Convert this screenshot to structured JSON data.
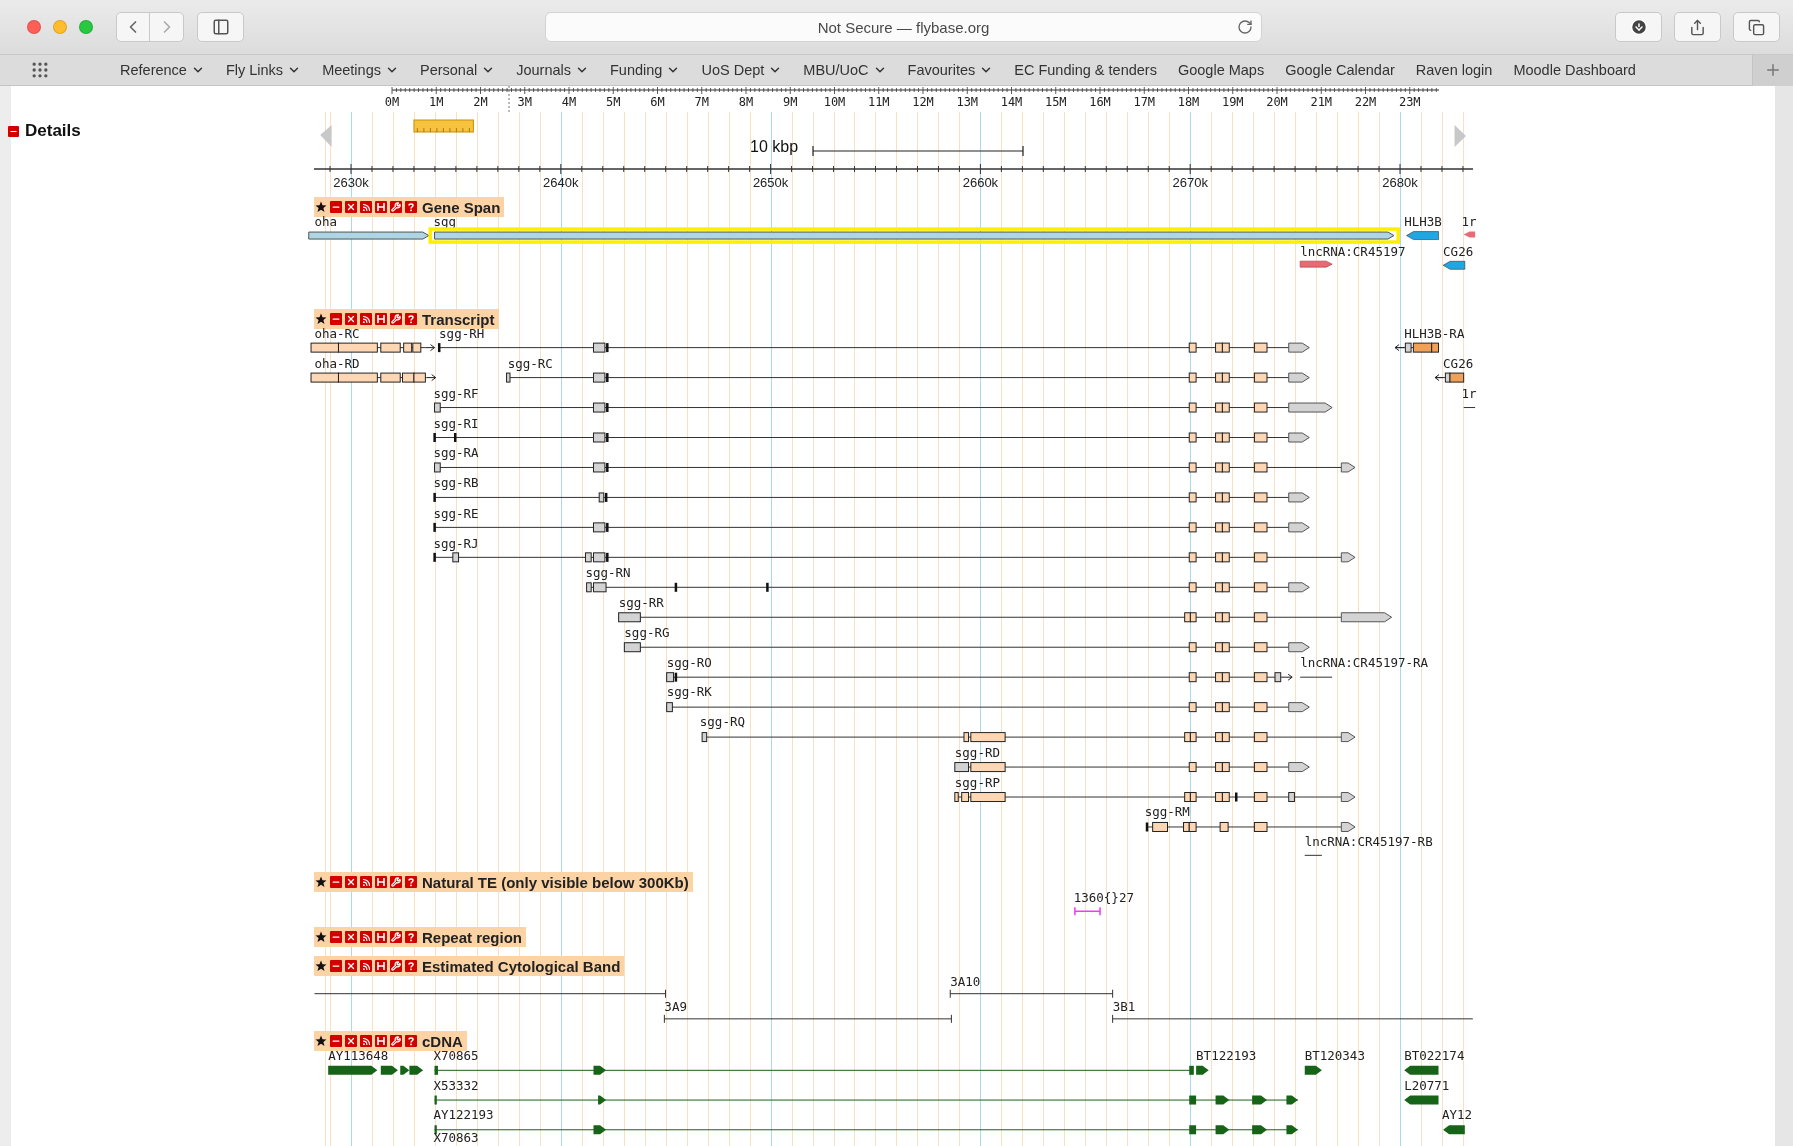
{
  "browser": {
    "address": "Not Secure — flybase.org"
  },
  "bookmarks": [
    {
      "label": "Reference",
      "menu": true
    },
    {
      "label": "Fly Links",
      "menu": true
    },
    {
      "label": "Meetings",
      "menu": true
    },
    {
      "label": "Personal",
      "menu": true
    },
    {
      "label": "Journals",
      "menu": true
    },
    {
      "label": "Funding",
      "menu": true
    },
    {
      "label": "UoS Dept",
      "menu": true
    },
    {
      "label": "MBU/UoC",
      "menu": true
    },
    {
      "label": "Favourites",
      "menu": true
    },
    {
      "label": "EC Funding & tenders",
      "menu": false
    },
    {
      "label": "Google Maps",
      "menu": false
    },
    {
      "label": "Google Calendar",
      "menu": false
    },
    {
      "label": "Raven login",
      "menu": false
    },
    {
      "label": "Moodle Dashboard",
      "menu": false
    }
  ],
  "sidebar": {
    "title": "Details"
  },
  "overview": {
    "ticks": [
      "0M",
      "1M",
      "2M",
      "3M",
      "4M",
      "5M",
      "6M",
      "7M",
      "8M",
      "9M",
      "10M",
      "11M",
      "12M",
      "13M",
      "14M",
      "15M",
      "16M",
      "17M",
      "18M",
      "19M",
      "20M",
      "21M",
      "22M",
      "23M"
    ]
  },
  "scale": {
    "label": "10 kbp"
  },
  "ruler": {
    "ticks": [
      "2630k",
      "2640k",
      "2650k",
      "2660k",
      "2670k",
      "2680k"
    ]
  },
  "tracks": [
    {
      "title": "Gene Span",
      "kind": "genespan",
      "features": [
        {
          "label": "oha",
          "selected": false
        },
        {
          "label": "sgg",
          "selected": true
        },
        {
          "label": "HLH3B",
          "selected": false
        },
        {
          "label": "1r",
          "selected": false
        },
        {
          "label": "lncRNA:CR45197",
          "selected": false
        },
        {
          "label": "CG26",
          "selected": false
        }
      ]
    },
    {
      "title": "Transcript",
      "kind": "transcript",
      "features": [
        {
          "label": "oha-RC"
        },
        {
          "label": "sgg-RH"
        },
        {
          "label": "HLH3B-RA"
        },
        {
          "label": "oha-RD"
        },
        {
          "label": "sgg-RC"
        },
        {
          "label": "CG26"
        },
        {
          "label": "sgg-RF"
        },
        {
          "label": "1r"
        },
        {
          "label": "sgg-RI"
        },
        {
          "label": "sgg-RA"
        },
        {
          "label": "sgg-RB"
        },
        {
          "label": "sgg-RE"
        },
        {
          "label": "sgg-RJ"
        },
        {
          "label": "sgg-RN"
        },
        {
          "label": "sgg-RR"
        },
        {
          "label": "sgg-RG"
        },
        {
          "label": "sgg-RO"
        },
        {
          "label": "lncRNA:CR45197-RA"
        },
        {
          "label": "sgg-RK"
        },
        {
          "label": "sgg-RQ"
        },
        {
          "label": "sgg-RD"
        },
        {
          "label": "sgg-RP"
        },
        {
          "label": "sgg-RM"
        },
        {
          "label": "lncRNA:CR45197-RB"
        }
      ]
    },
    {
      "title": "Natural TE (only visible below 300Kb)",
      "kind": "te",
      "features": [
        {
          "label": "1360{}27"
        }
      ]
    },
    {
      "title": "Repeat region",
      "kind": "repeat"
    },
    {
      "title": "Estimated Cytological Band",
      "kind": "band",
      "features": [
        {
          "label": "3A10"
        },
        {
          "label": "3A9"
        },
        {
          "label": "3B1"
        }
      ]
    },
    {
      "title": "cDNA",
      "kind": "cdna",
      "features": [
        {
          "label": "AY113648"
        },
        {
          "label": "X70865"
        },
        {
          "label": "BT122193"
        },
        {
          "label": "BT120343"
        },
        {
          "label": "BT022174"
        },
        {
          "label": "X53332"
        },
        {
          "label": "L20771"
        },
        {
          "label": "AY122193"
        },
        {
          "label": "AY12"
        },
        {
          "label": "X70863"
        }
      ]
    }
  ]
}
